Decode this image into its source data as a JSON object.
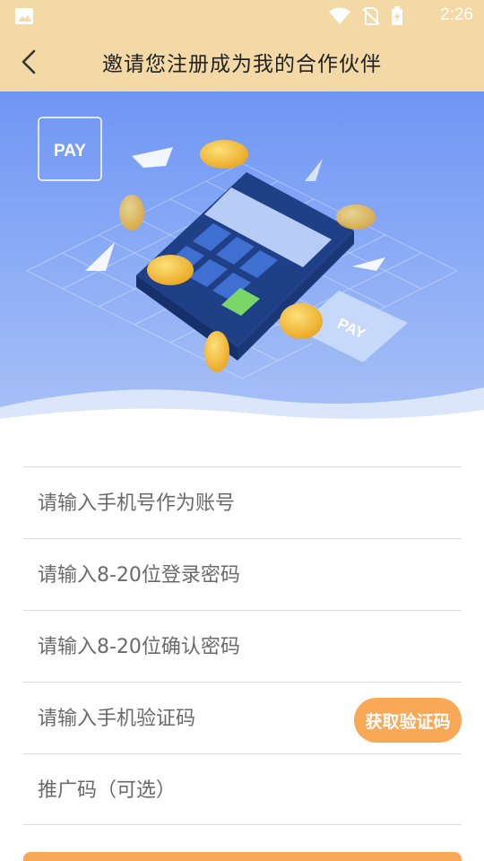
{
  "status_bar": {
    "time": "2:26"
  },
  "header": {
    "title": "邀请您注册成为我的合作伙伴",
    "back_icon": "chevron-left-icon"
  },
  "banner": {
    "pay_badge": "PAY",
    "card_label": "PAY",
    "colors": {
      "bg_top": "#6f96f4",
      "bg_bottom": "#a9c2f7",
      "coin": "#f4b731",
      "terminal": "#1f3f86"
    }
  },
  "form": {
    "phone_placeholder": "请输入手机号作为账号",
    "password_placeholder": "请输入8-20位登录密码",
    "confirm_placeholder": "请输入8-20位确认密码",
    "sms_placeholder": "请输入手机验证码",
    "get_code_label": "获取验证码",
    "promo_placeholder": "推广码（可选）"
  },
  "colors": {
    "header_bg": "#f3d9a5",
    "accent": "#f9a855"
  }
}
